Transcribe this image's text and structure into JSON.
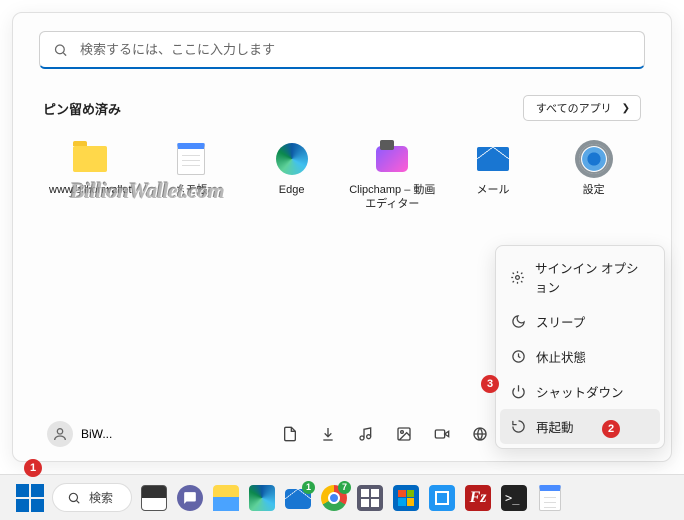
{
  "search": {
    "placeholder": "検索するには、ここに入力します"
  },
  "pinned": {
    "title": "ピン留め済み",
    "all_apps": "すべてのアプリ",
    "items": [
      {
        "label": "www.billionwallet"
      },
      {
        "label": "メモ帳"
      },
      {
        "label": "Edge"
      },
      {
        "label": "Clipchamp – 動画エディター"
      },
      {
        "label": "メール"
      },
      {
        "label": "設定"
      }
    ]
  },
  "power_menu": {
    "signin_options": "サインイン オプション",
    "sleep": "スリープ",
    "hibernate": "休止状態",
    "shutdown": "シャットダウン",
    "restart": "再起動"
  },
  "user": {
    "name": "BiW..."
  },
  "taskbar": {
    "search": "検索"
  },
  "watermark": "BillionWallet.com",
  "callouts": {
    "c1": "1",
    "c2": "2",
    "c3": "3"
  },
  "tb_badges": {
    "mail": "1",
    "edge2": "7"
  }
}
